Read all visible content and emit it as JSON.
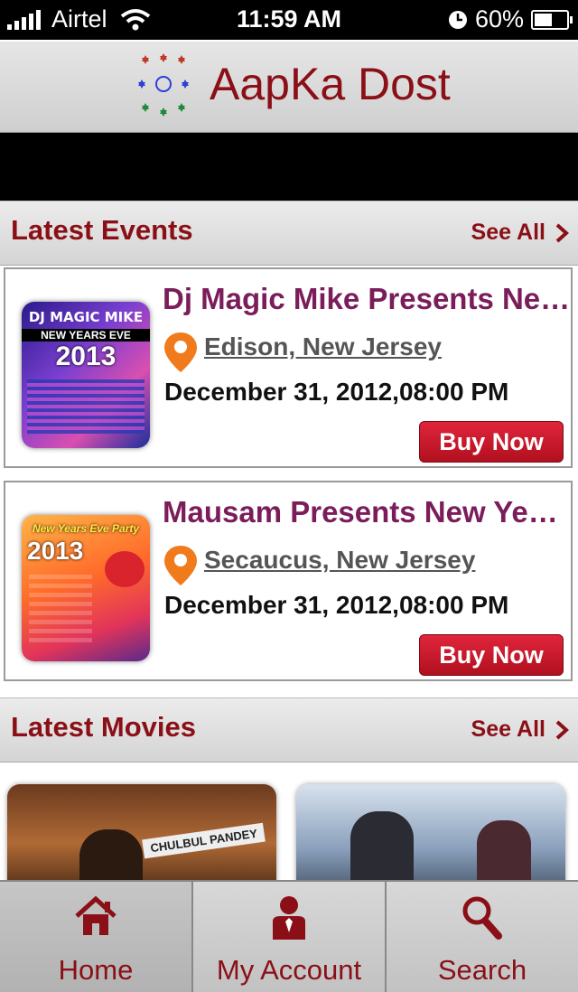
{
  "status_bar": {
    "carrier": "Airtel",
    "time": "11:59 AM",
    "battery_percent": "60%",
    "battery_level": 0.6,
    "icons": [
      "signal-icon",
      "wifi-icon",
      "clock-icon",
      "battery-icon"
    ]
  },
  "header": {
    "title": "AapKa Dost",
    "logo": "aapka-dost-logo-icon"
  },
  "events_section": {
    "title": "Latest Events",
    "see_all": "See All"
  },
  "events": [
    {
      "title": "Dj Magic Mike Presents New...",
      "location": "Edison, New Jersey",
      "datetime": "December 31, 2012,08:00 PM",
      "buy_label": "Buy Now",
      "poster_text": [
        "DJ MAGIC MIKE",
        "NEW YEARS EVE",
        "2013"
      ]
    },
    {
      "title": "Mausam Presents New Year...",
      "location": "Secaucus, New Jersey",
      "datetime": "December 31, 2012,08:00 PM",
      "buy_label": "Buy Now",
      "poster_text": [
        "New Years Eve Party",
        "2013"
      ]
    }
  ],
  "movies_section": {
    "title": "Latest Movies",
    "see_all": "See All"
  },
  "movies": [
    {
      "poster_text": "CHULBUL PANDEY"
    },
    {
      "poster_text": ""
    }
  ],
  "tabbar": {
    "tabs": [
      {
        "label": "Home",
        "icon": "home-icon",
        "active": true
      },
      {
        "label": "My Account",
        "icon": "account-icon",
        "active": false
      },
      {
        "label": "Search",
        "icon": "search-icon",
        "active": false
      }
    ]
  },
  "colors": {
    "brand": "#8a0f16",
    "event_title": "#7a1d5a",
    "buy_button": "#c8182b",
    "pin": "#f07b1c"
  }
}
